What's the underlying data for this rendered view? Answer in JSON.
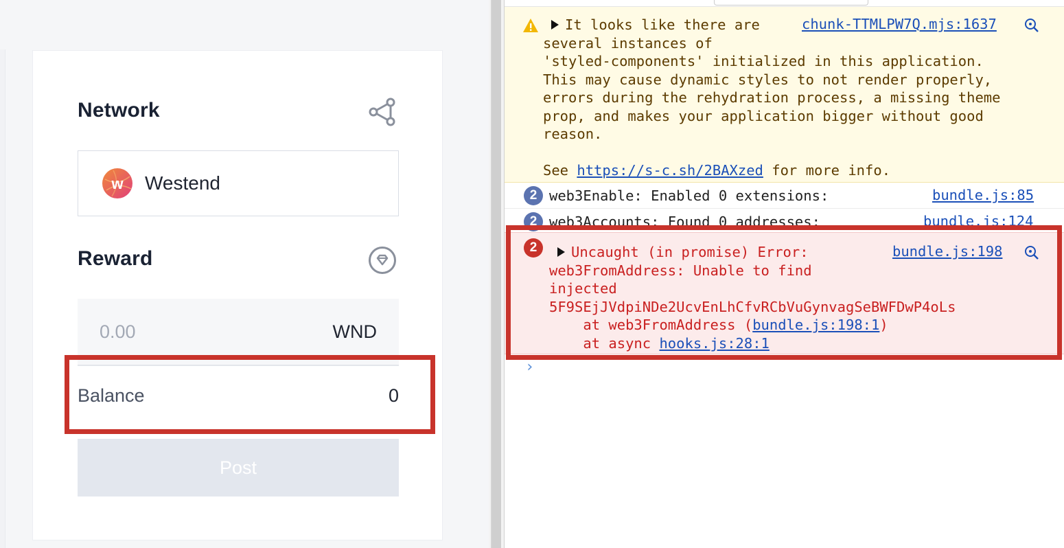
{
  "app": {
    "network_title": "Network",
    "network_name": "Westend",
    "network_logo_letter": "w",
    "reward_title": "Reward",
    "reward_placeholder": "0.00",
    "reward_unit": "WND",
    "balance_label": "Balance",
    "balance_value": "0",
    "post_label": "Post",
    "icons": {
      "network": "share-nodes-icon",
      "reward": "diamond-badge-icon"
    },
    "colors": {
      "highlight": "#c8332b",
      "logo_gradient_start": "#f08a3a",
      "logo_gradient_end": "#e0407a"
    }
  },
  "console": {
    "warning": {
      "lines": [
        "It looks like there are",
        "several instances of",
        "'styled-components' initialized in this application.",
        "This may cause dynamic styles to not render properly,",
        "errors during the rehydration process, a missing theme",
        "prop, and makes your application bigger without good",
        "reason."
      ],
      "see_prefix": "See ",
      "see_link": "https://s-c.sh/2BAXzed",
      "see_suffix": " for more info.",
      "source": "chunk-TTMLPW7Q.mjs:1637"
    },
    "info1": {
      "count": "2",
      "text": "web3Enable: Enabled 0 extensions:",
      "source": "bundle.js:85"
    },
    "info2": {
      "count": "2",
      "text": "web3Accounts: Found 0 addresses:",
      "source": "bundle.js:124"
    },
    "error": {
      "count": "2",
      "lines": [
        "Uncaught (in promise) Error:",
        "web3FromAddress: Unable to find",
        "injected",
        "5F9SEjJVdpiNDe2UcvEnLhCfvRCbVuGynvagSeBWFDwP4oLs"
      ],
      "stack1_prefix": "    at web3FromAddress (",
      "stack1_link": "bundle.js:198:1",
      "stack1_suffix": ")",
      "stack2_prefix": "    at async ",
      "stack2_link": "hooks.js:28:1",
      "source": "bundle.js:198"
    },
    "prompt": "›"
  }
}
